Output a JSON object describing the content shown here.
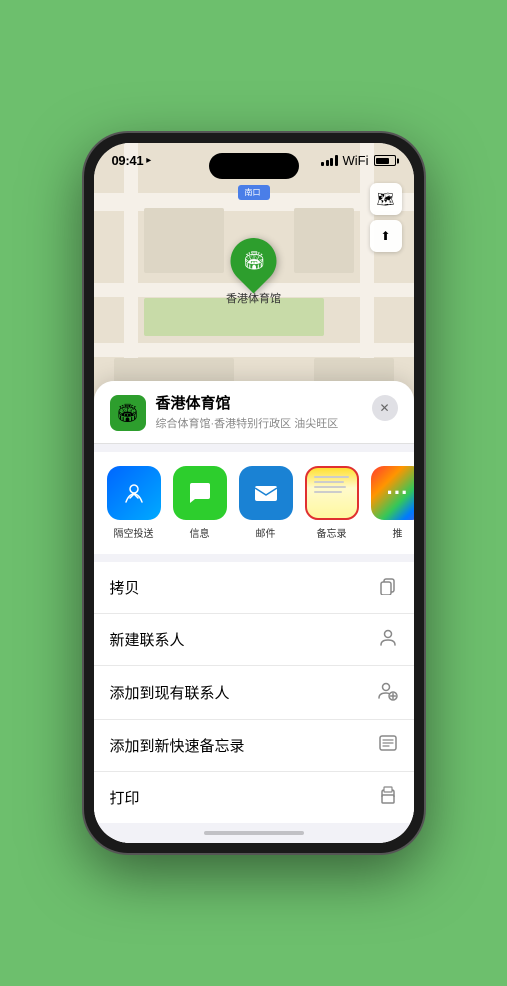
{
  "statusBar": {
    "time": "09:41",
    "arrow": "▸"
  },
  "mapLabel": {
    "entrance": "南口"
  },
  "mapControls": {
    "mapViewIcon": "🗺",
    "locationIcon": "⤒"
  },
  "pin": {
    "label": "香港体育馆",
    "emoji": "🏟"
  },
  "placeHeader": {
    "name": "香港体育馆",
    "subtitle": "综合体育馆·香港特别行政区 油尖旺区",
    "closeLabel": "✕",
    "iconEmoji": "🏟"
  },
  "shareRow": [
    {
      "id": "airdrop",
      "label": "隔空投送",
      "type": "airdrop"
    },
    {
      "id": "message",
      "label": "信息",
      "type": "message"
    },
    {
      "id": "mail",
      "label": "邮件",
      "type": "mail"
    },
    {
      "id": "notes",
      "label": "备忘录",
      "type": "notes"
    },
    {
      "id": "more",
      "label": "推",
      "type": "more"
    }
  ],
  "actionItems": [
    {
      "id": "copy",
      "label": "拷贝",
      "icon": "⎘"
    },
    {
      "id": "new-contact",
      "label": "新建联系人",
      "icon": "👤"
    },
    {
      "id": "add-existing",
      "label": "添加到现有联系人",
      "icon": "👤"
    },
    {
      "id": "quick-note",
      "label": "添加到新快速备忘录",
      "icon": "⊡"
    },
    {
      "id": "print",
      "label": "打印",
      "icon": "🖨"
    }
  ]
}
